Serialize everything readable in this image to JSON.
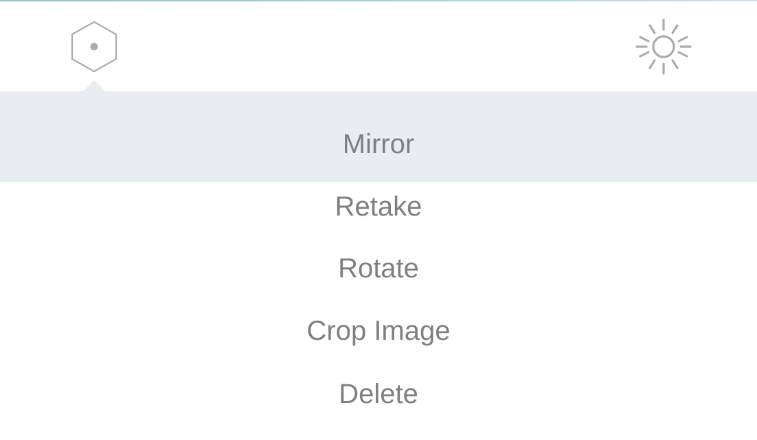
{
  "toolbar": {
    "left_icon": "hexagon-dot-icon",
    "right_icon": "sun-brightness-icon"
  },
  "menu": {
    "items": [
      {
        "label": "Mirror",
        "selected": true
      },
      {
        "label": "Retake",
        "selected": false
      },
      {
        "label": "Rotate",
        "selected": false
      },
      {
        "label": "Crop Image",
        "selected": false
      },
      {
        "label": "Delete",
        "selected": false
      }
    ]
  },
  "colors": {
    "accent_gradient_start": "#8fc3c9",
    "accent_gradient_end": "#c7e3ee",
    "highlight": "#e9ecf0",
    "text": "#7f7f7f",
    "icon": "#a8abaf"
  }
}
